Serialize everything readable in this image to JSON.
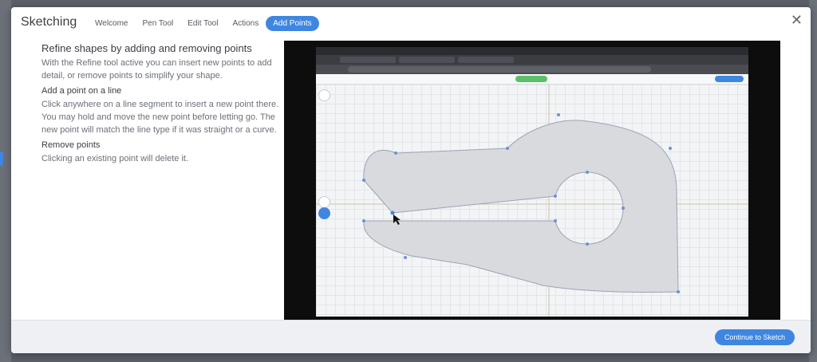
{
  "header": {
    "title": "Sketching",
    "tabs": [
      "Welcome",
      "Pen Tool",
      "Edit Tool",
      "Actions",
      "Add Points"
    ],
    "active_tab": "Add Points",
    "close_icon": "close-icon"
  },
  "content": {
    "heading": "Refine shapes by adding and removing points",
    "intro": "With the Refine tool active you can insert new points to add detail, or remove points to simplify your shape.",
    "add_title": "Add a point on a line",
    "add_body": "Click anywhere on a line segment to insert a new point there. You may hold and move the new point before letting go. The new point will match the line type if it was straight or a curve.",
    "remove_title": "Remove points",
    "remove_body": "Clicking an existing point will delete it."
  },
  "footer": {
    "continue_label": "Continue to Sketch"
  },
  "colors": {
    "accent": "#3f86e0",
    "green": "#5bbf6a",
    "shape_fill": "#d9dadd"
  }
}
